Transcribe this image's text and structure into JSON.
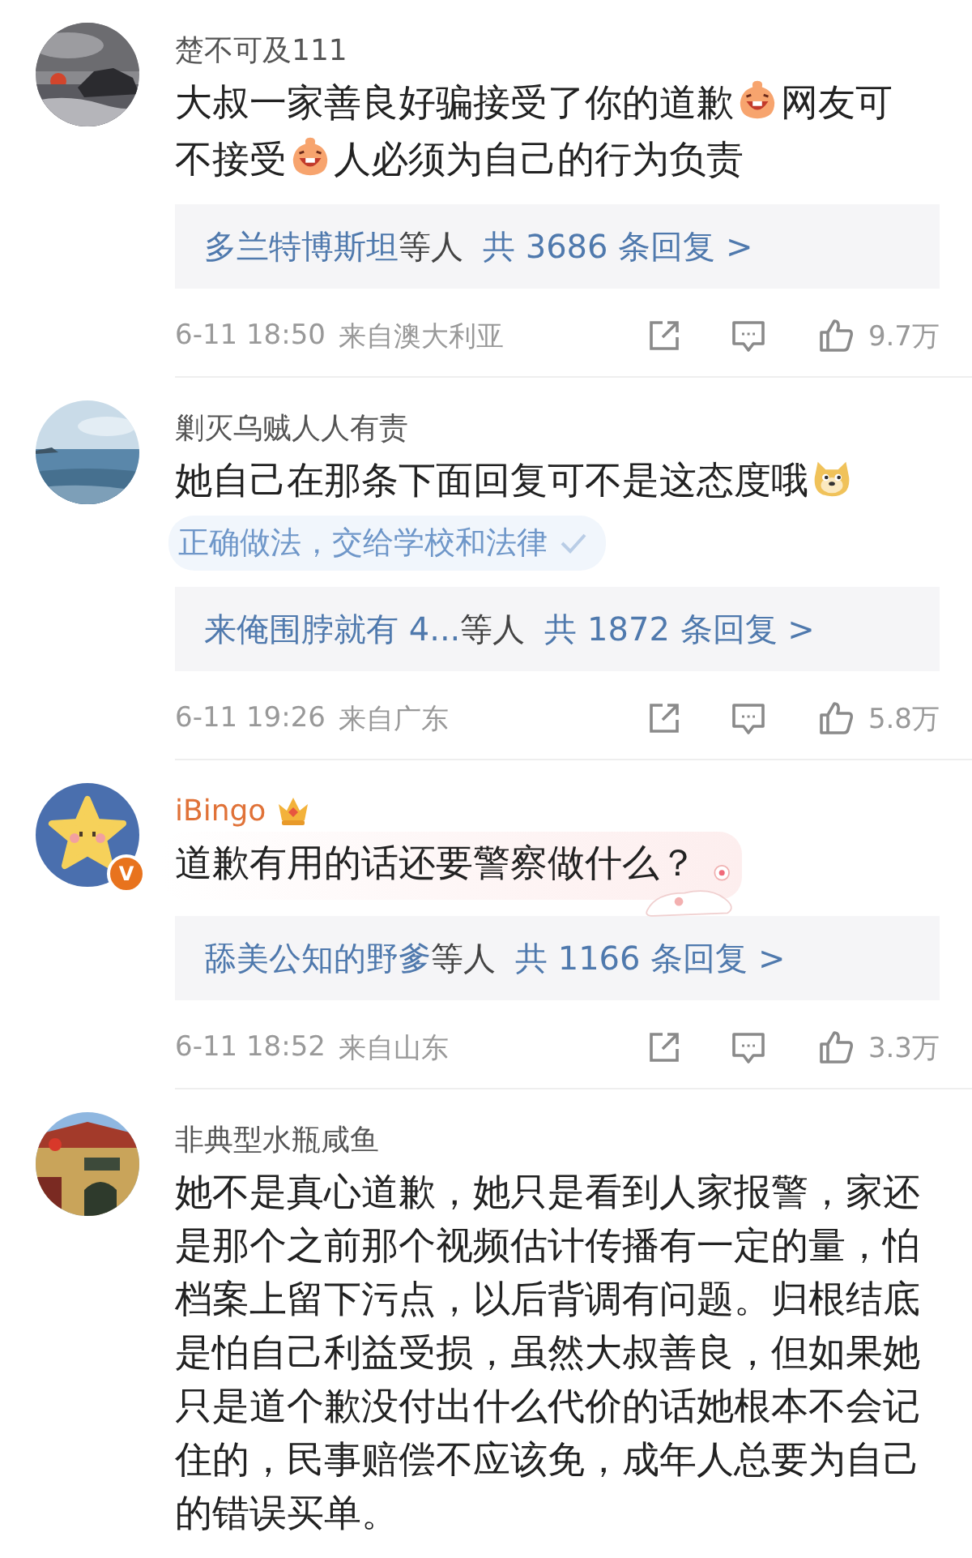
{
  "comments": [
    {
      "avatar": {
        "kind": "picture"
      },
      "name": "楚不可及111",
      "vip": false,
      "lines": [
        [
          {
            "kind": "text",
            "text": "大叔一家善良好骗接受了你的道歉"
          },
          {
            "kind": "grin"
          },
          {
            "kind": "text",
            "text": "网友可"
          }
        ],
        [
          {
            "kind": "text",
            "text": "不接受"
          },
          {
            "kind": "grin"
          },
          {
            "kind": "text",
            "text": "人必须为自己的行为负责"
          }
        ]
      ],
      "reply": {
        "users": "多兰特博斯坦",
        "others": "等人",
        "total": "共 3686 条回复 >"
      },
      "time": "6-11 18:50",
      "location": "来自澳大利亚",
      "likes": "9.7万"
    },
    {
      "avatar": {
        "kind": "picture"
      },
      "name": "剿灭乌贼人人有责",
      "vip": false,
      "lines": [
        [
          {
            "kind": "text",
            "text": "她自己在那条下面回复可不是这态度哦"
          },
          {
            "kind": "doge"
          }
        ]
      ],
      "tag": "正确做法，交给学校和法律",
      "reply": {
        "users": "来俺围脖就有 4...",
        "others": "等人",
        "total": "共 1872 条回复 >"
      },
      "time": "6-11 19:26",
      "location": "来自广东",
      "likes": "5.8万"
    },
    {
      "avatar": {
        "kind": "picture"
      },
      "name": "iBingo",
      "vip": true,
      "verified_badge": "V",
      "bubble": true,
      "lines": [
        [
          {
            "kind": "text",
            "text": "道歉有用的话还要警察做什么？"
          }
        ]
      ],
      "reply": {
        "users": "舔美公知的野爹",
        "others": "等人",
        "total": "共 1166 条回复 >"
      },
      "time": "6-11 18:52",
      "location": "来自山东",
      "likes": "3.3万"
    },
    {
      "avatar": {
        "kind": "picture"
      },
      "name": "非典型水瓶咸鱼",
      "vip": false,
      "paragraph": "她不是真心道歉，她只是看到人家报警，家还是那个之前那个视频估计传播有一定的量，怕档案上留下污点，以后背调有问题。归根结底是怕自己利益受损，虽然大叔善良，但如果她只是道个歉没付出什么代价的话她根本不会记住的，民事赔偿不应该免，成年人总要为自己的错误买单。"
    }
  ]
}
